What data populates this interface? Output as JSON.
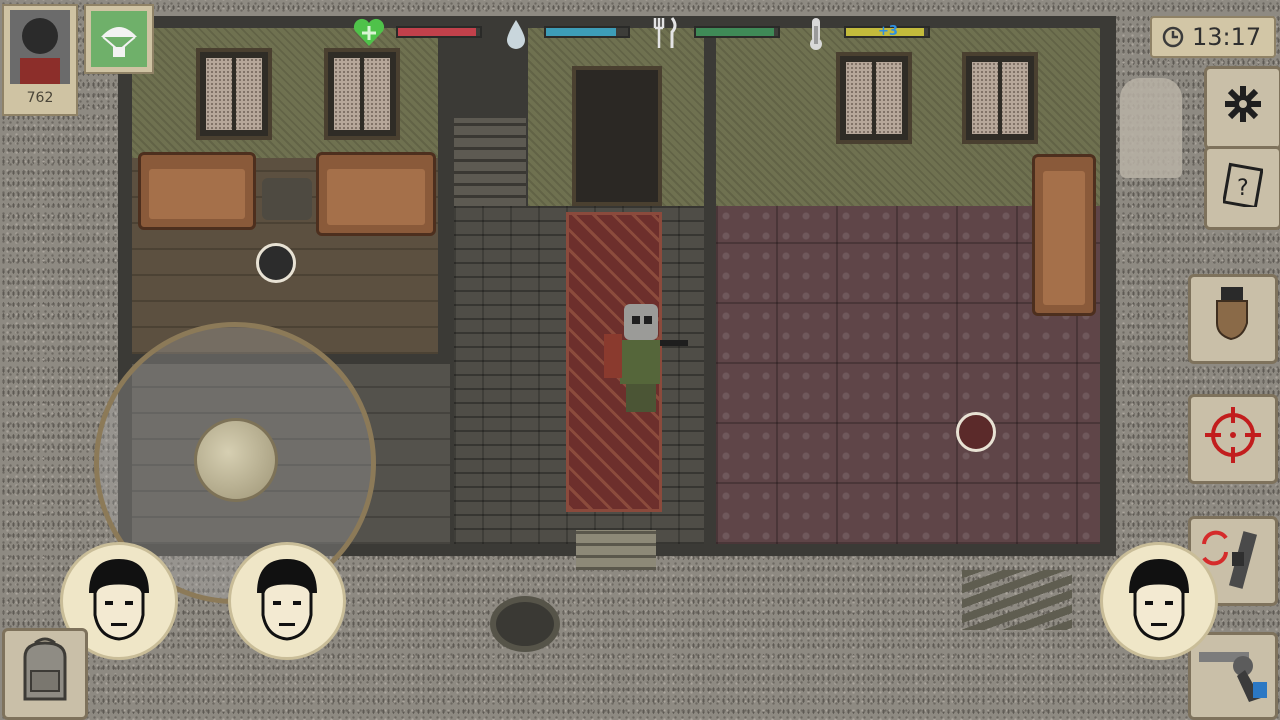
{
  "player": {
    "score": "762",
    "avatar_icon": "gas-mask-soldier-icon",
    "airdrop_icon": "parachute-crate-icon"
  },
  "status": {
    "health": 0.95,
    "thirst": 0.85,
    "hunger": 0.95,
    "temperature_label": "+3",
    "temperature": 0.95,
    "colors": {
      "health": "#c2414b",
      "thirst": "#3d9db8",
      "hunger": "#3f8a57",
      "temperature": "#c3bb3c"
    }
  },
  "clock": {
    "time": "13:17"
  },
  "side_buttons": {
    "settings_icon": "gear-icon",
    "quests_icon": "quest-note-icon",
    "melee_icon": "fist-icon",
    "aim_icon": "crosshair-icon",
    "reload_icon": "rifle-swap-icon",
    "weapon_icon": "revolver-icon"
  },
  "bottom": {
    "backpack_icon": "backpack-icon",
    "companions": [
      "companion-face",
      "companion-face",
      "companion-face"
    ]
  }
}
